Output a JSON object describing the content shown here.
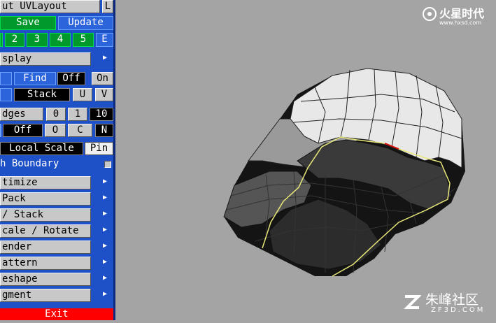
{
  "title": "ut UVLayout",
  "top_btn": "L",
  "save": "Save",
  "update": "Update",
  "num_tabs": [
    "2",
    "3",
    "4",
    "5",
    "E"
  ],
  "display": "splay",
  "find_row": {
    "find": "Find",
    "off": "Off",
    "on": "On"
  },
  "stack_row": {
    "stack": "Stack",
    "u": "U",
    "v": "V"
  },
  "edges_row": {
    "label": "dges",
    "a": "0",
    "b": "1",
    "c": "10"
  },
  "off_row": {
    "off": "Off",
    "o": "O",
    "c": "C",
    "n": "N"
  },
  "local_scale": {
    "label": "Local Scale",
    "pin": "Pin"
  },
  "boundary": "h Boundary",
  "menus": [
    "timize",
    "Pack",
    "/ Stack",
    "cale / Rotate",
    "ender",
    "attern",
    "eshape",
    "gment"
  ],
  "exit": "Exit",
  "watermark_top": {
    "cn": "火星时代",
    "url": "www.hxsd.com"
  },
  "watermark_bottom": {
    "cn": "朱峰社区",
    "en": "ZF3D.COM"
  },
  "arrow_glyph": "▶"
}
